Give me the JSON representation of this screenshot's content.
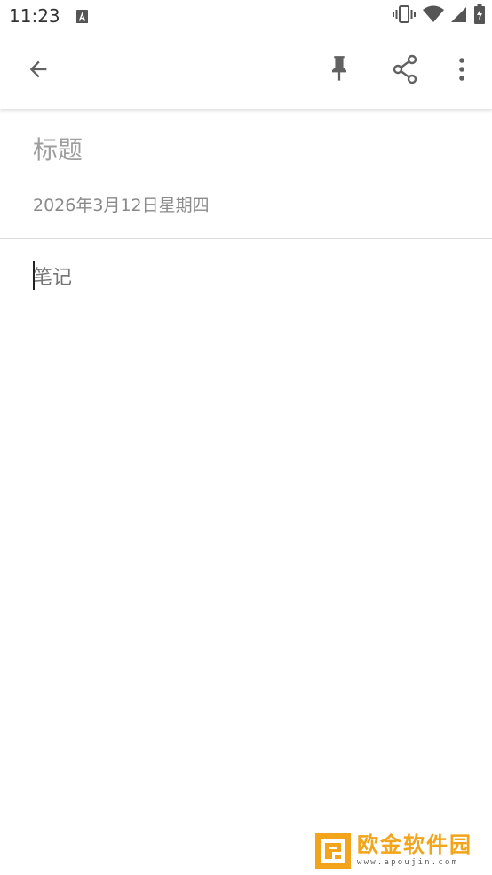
{
  "status_bar": {
    "time": "11:23",
    "icons": [
      "text-notification-icon",
      "vibrate-icon",
      "wifi-icon",
      "cell-signal-icon",
      "battery-charging-icon"
    ]
  },
  "app_bar": {
    "icons": [
      "back-arrow-icon",
      "pin-icon",
      "share-icon",
      "more-vert-icon"
    ]
  },
  "note": {
    "title_placeholder": "标题",
    "date": "2026年3月12日星期四",
    "body_placeholder": "笔记"
  },
  "watermark": {
    "title": "欧金软件园",
    "url": "www.apoujin.com"
  },
  "colors": {
    "icon": "#616161",
    "placeholder": "#9e9e9e",
    "watermark": "#f2a51a"
  }
}
